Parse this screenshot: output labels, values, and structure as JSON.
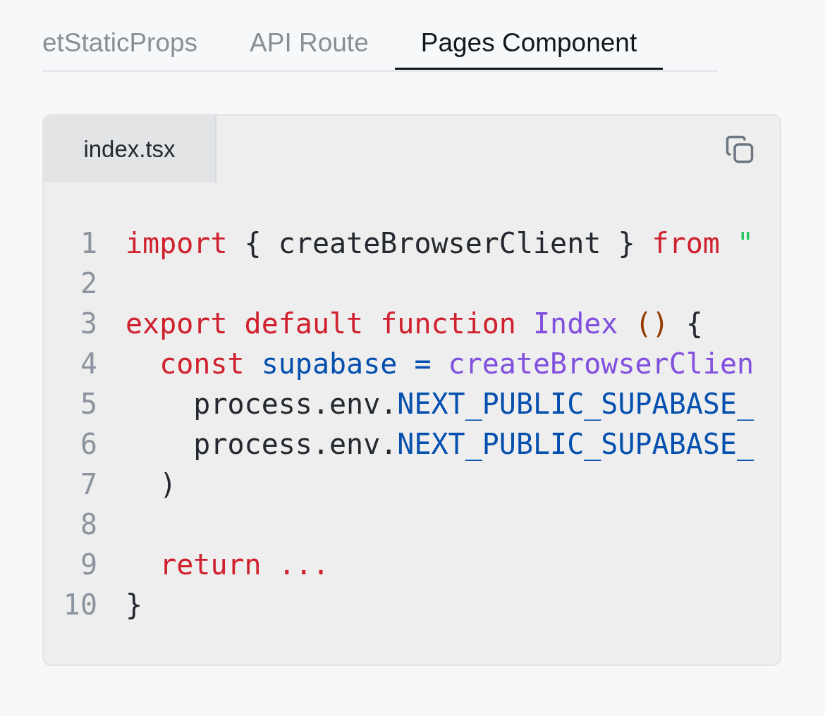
{
  "tabs": [
    {
      "label": "etStaticProps",
      "selected": false
    },
    {
      "label": "API Route",
      "selected": false
    },
    {
      "label": "Pages Component",
      "selected": true
    }
  ],
  "code_panel": {
    "file_tab": "index.tsx",
    "lines": [
      {
        "number": "1",
        "tokens": [
          {
            "text": "import",
            "kind": "keyword"
          },
          {
            "text": " { createBrowserClient } ",
            "kind": "plain"
          },
          {
            "text": "from",
            "kind": "keyword"
          },
          {
            "text": " \"",
            "kind": "string"
          }
        ]
      },
      {
        "number": "2"
      },
      {
        "number": "3",
        "tokens": [
          {
            "text": "export default function",
            "kind": "keyword"
          },
          {
            "text": " Index ",
            "kind": "func"
          },
          {
            "text": "()",
            "kind": "paren"
          },
          {
            "text": " {",
            "kind": "plain"
          }
        ]
      },
      {
        "number": "4",
        "tokens": [
          {
            "text": "  const",
            "kind": "keyword"
          },
          {
            "text": " supabase = ",
            "kind": "name"
          },
          {
            "text": "createBrowserClien",
            "kind": "func"
          }
        ]
      },
      {
        "number": "5",
        "tokens": [
          {
            "text": "    process.env.",
            "kind": "plain"
          },
          {
            "text": "NEXT_PUBLIC_SUPABASE_",
            "kind": "name"
          }
        ]
      },
      {
        "number": "6",
        "tokens": [
          {
            "text": "    process.env.",
            "kind": "plain"
          },
          {
            "text": "NEXT_PUBLIC_SUPABASE_",
            "kind": "name"
          }
        ]
      },
      {
        "number": "7",
        "tokens": [
          {
            "text": "  )",
            "kind": "plain"
          }
        ]
      },
      {
        "number": "8"
      },
      {
        "number": "9",
        "tokens": [
          {
            "text": "  return ...",
            "kind": "keyword"
          }
        ]
      },
      {
        "number": "10",
        "tokens": [
          {
            "text": "}",
            "kind": "plain"
          }
        ]
      }
    ]
  }
}
